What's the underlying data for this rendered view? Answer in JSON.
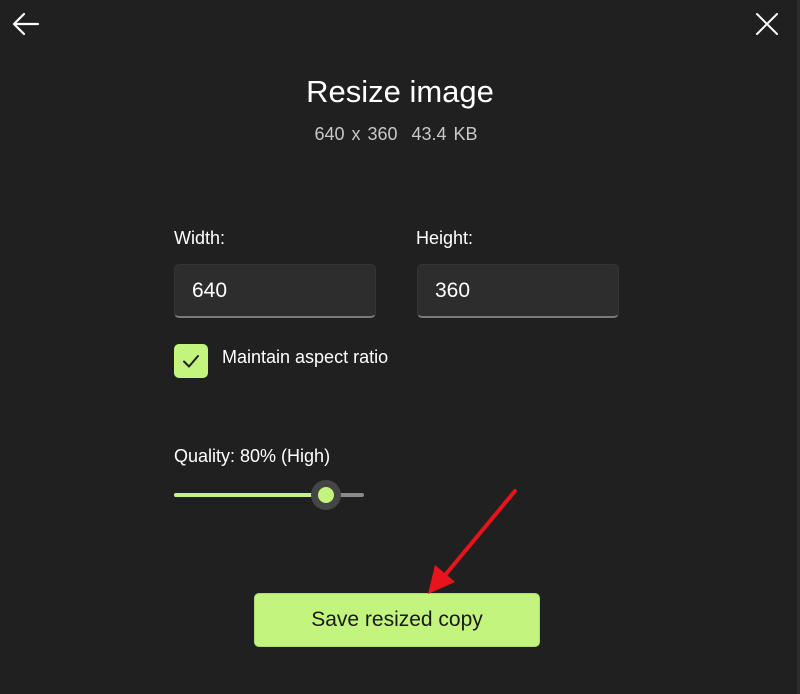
{
  "window": {
    "title": "Resize image",
    "image_dimensions": "640 x 360",
    "file_size": "43.4 KB"
  },
  "icons": {
    "back": "arrow-left-icon",
    "close": "close-icon",
    "check": "checkmark-icon"
  },
  "form": {
    "width_label": "Width:",
    "width_value": "640",
    "height_label": "Height:",
    "height_value": "360",
    "aspect_label": "Maintain aspect ratio",
    "aspect_checked": true,
    "quality_label": "Quality: 80% (High)",
    "quality_percent": 80
  },
  "actions": {
    "save_label": "Save resized copy"
  },
  "colors": {
    "background": "#202020",
    "accent": "#c3f47e",
    "field_bg": "#2d2d2d",
    "annotation_arrow": "#e8141c"
  }
}
